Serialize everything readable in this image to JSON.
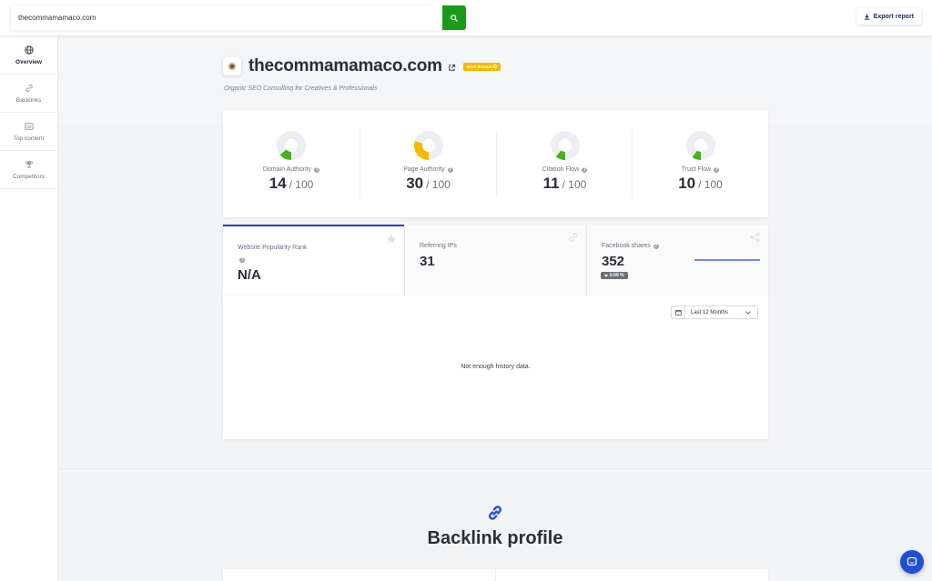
{
  "search": {
    "value": "thecommamamaco.com",
    "placeholder": ""
  },
  "toolbar": {
    "export_label": "Export report"
  },
  "sidebar": {
    "items": [
      {
        "label": "Overview",
        "icon": "globe-icon",
        "active": true
      },
      {
        "label": "Backlinks",
        "icon": "link-icon",
        "active": false
      },
      {
        "label": "Top content",
        "icon": "content-icon",
        "active": false
      },
      {
        "label": "Competitors",
        "icon": "trophy-icon",
        "active": false
      }
    ]
  },
  "site": {
    "domain": "thecommamamaco.com",
    "badge": "Root domain",
    "tagline": "Organic SEO Consulting for Creatives & Professionals"
  },
  "metrics": [
    {
      "label": "Domain Authority",
      "value": "14",
      "max": "/ 100",
      "fraction": 0.14,
      "color": "#4caf1e"
    },
    {
      "label": "Page Authority",
      "value": "30",
      "max": "/ 100",
      "fraction": 0.3,
      "color": "#f6b800"
    },
    {
      "label": "Citation Flow",
      "value": "11",
      "max": "/ 100",
      "fraction": 0.11,
      "color": "#4caf1e"
    },
    {
      "label": "Trust Flow",
      "value": "10",
      "max": "/ 100",
      "fraction": 0.1,
      "color": "#4caf1e"
    }
  ],
  "stats": [
    {
      "label": "Website Popularity Rank",
      "value": "N/A",
      "icon": "star-icon"
    },
    {
      "label": "Referring IPs",
      "value": "31",
      "icon": "link-icon"
    },
    {
      "label": "Facebook shares",
      "value": "352",
      "change": "0.00 %",
      "icon": "share-icon"
    }
  ],
  "history": {
    "period": "Last 12 Months",
    "empty_message": "Not enough history data."
  },
  "backlinks": {
    "title": "Backlink profile"
  },
  "colors": {
    "accent": "#1f4fd6",
    "search_button": "#1a9a1a",
    "badge": "#f6b800",
    "tab_active": "#2340c8"
  }
}
